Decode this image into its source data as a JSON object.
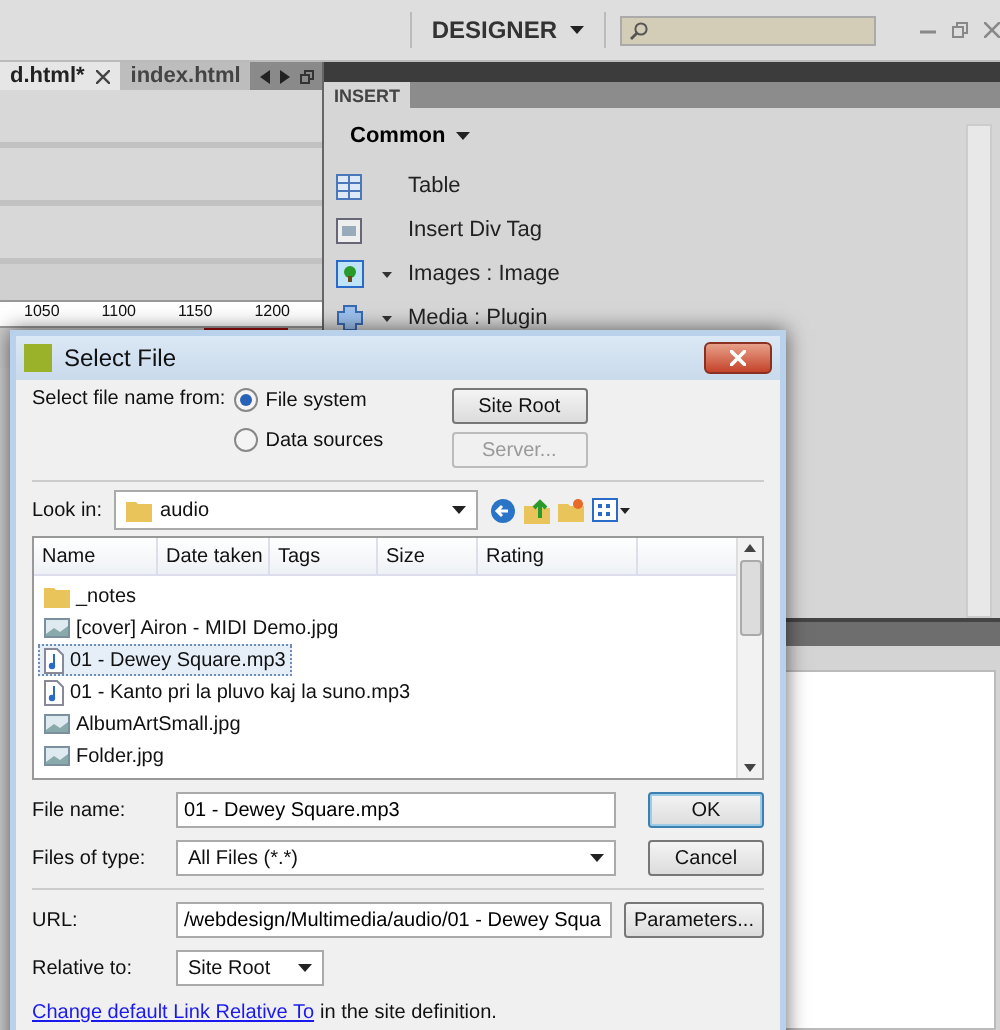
{
  "top_bar": {
    "workspace": "DESIGNER"
  },
  "document_tabs": [
    {
      "label": "d.html*",
      "selected": true
    },
    {
      "label": "index.html",
      "selected": false
    }
  ],
  "ruler": [
    "1050",
    "1100",
    "1150",
    "1200"
  ],
  "insert_panel": {
    "title": "INSERT",
    "category": "Common",
    "items": [
      {
        "label": "Table",
        "kind": "table",
        "has_menu": false
      },
      {
        "label": "Insert Div Tag",
        "kind": "div",
        "has_menu": false
      },
      {
        "label": "Images : Image",
        "kind": "image",
        "has_menu": true
      },
      {
        "label": "Media : Plugin",
        "kind": "plugin",
        "has_menu": true
      }
    ]
  },
  "dialog": {
    "title": "Select File",
    "select_from_label": "Select file name from:",
    "sources": [
      {
        "label": "File system",
        "selected": true
      },
      {
        "label": "Data sources",
        "selected": false
      }
    ],
    "source_buttons": [
      {
        "label": "Site Root",
        "disabled": false
      },
      {
        "label": "Server...",
        "disabled": true
      }
    ],
    "look_in_label": "Look in:",
    "look_in": "audio",
    "columns": [
      "Name",
      "Date taken",
      "Tags",
      "Size",
      "Rating"
    ],
    "files": [
      {
        "name": "_notes",
        "kind": "folder",
        "selected": false
      },
      {
        "name": "[cover] Airon - MIDI Demo.jpg",
        "kind": "image",
        "selected": false
      },
      {
        "name": "01 - Dewey Square.mp3",
        "kind": "audio",
        "selected": true
      },
      {
        "name": "01 - Kanto pri la pluvo kaj la suno.mp3",
        "kind": "audio",
        "selected": false
      },
      {
        "name": "AlbumArtSmall.jpg",
        "kind": "image",
        "selected": false
      },
      {
        "name": "Folder.jpg",
        "kind": "image",
        "selected": false
      }
    ],
    "file_name_label": "File name:",
    "file_name": "01 - Dewey Square.mp3",
    "files_of_type_label": "Files of type:",
    "files_of_type": "All Files (*.*)",
    "ok": "OK",
    "cancel": "Cancel",
    "url_label": "URL:",
    "url": "/webdesign/Multimedia/audio/01 - Dewey Squa",
    "parameters": "Parameters...",
    "relative_to_label": "Relative to:",
    "relative_to": "Site Root",
    "link": "Change default Link Relative To",
    "link_suffix": "in the site definition."
  }
}
